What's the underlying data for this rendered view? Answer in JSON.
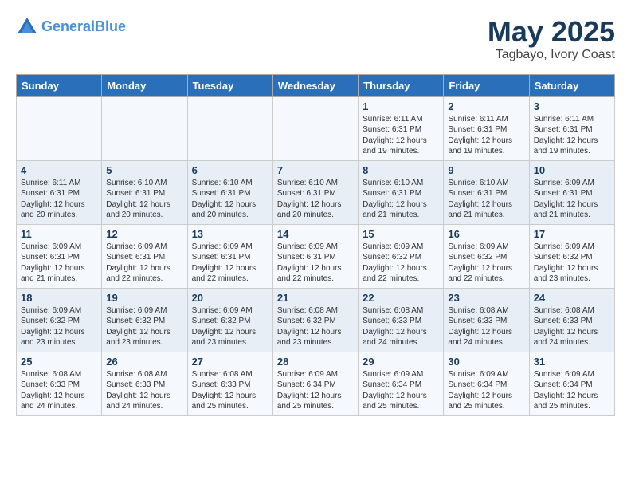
{
  "header": {
    "logo_line1": "General",
    "logo_line2": "Blue",
    "month": "May 2025",
    "location": "Tagbayo, Ivory Coast"
  },
  "days_of_week": [
    "Sunday",
    "Monday",
    "Tuesday",
    "Wednesday",
    "Thursday",
    "Friday",
    "Saturday"
  ],
  "weeks": [
    [
      {
        "day": "",
        "info": ""
      },
      {
        "day": "",
        "info": ""
      },
      {
        "day": "",
        "info": ""
      },
      {
        "day": "",
        "info": ""
      },
      {
        "day": "1",
        "info": "Sunrise: 6:11 AM\nSunset: 6:31 PM\nDaylight: 12 hours\nand 19 minutes."
      },
      {
        "day": "2",
        "info": "Sunrise: 6:11 AM\nSunset: 6:31 PM\nDaylight: 12 hours\nand 19 minutes."
      },
      {
        "day": "3",
        "info": "Sunrise: 6:11 AM\nSunset: 6:31 PM\nDaylight: 12 hours\nand 19 minutes."
      }
    ],
    [
      {
        "day": "4",
        "info": "Sunrise: 6:11 AM\nSunset: 6:31 PM\nDaylight: 12 hours\nand 20 minutes."
      },
      {
        "day": "5",
        "info": "Sunrise: 6:10 AM\nSunset: 6:31 PM\nDaylight: 12 hours\nand 20 minutes."
      },
      {
        "day": "6",
        "info": "Sunrise: 6:10 AM\nSunset: 6:31 PM\nDaylight: 12 hours\nand 20 minutes."
      },
      {
        "day": "7",
        "info": "Sunrise: 6:10 AM\nSunset: 6:31 PM\nDaylight: 12 hours\nand 20 minutes."
      },
      {
        "day": "8",
        "info": "Sunrise: 6:10 AM\nSunset: 6:31 PM\nDaylight: 12 hours\nand 21 minutes."
      },
      {
        "day": "9",
        "info": "Sunrise: 6:10 AM\nSunset: 6:31 PM\nDaylight: 12 hours\nand 21 minutes."
      },
      {
        "day": "10",
        "info": "Sunrise: 6:09 AM\nSunset: 6:31 PM\nDaylight: 12 hours\nand 21 minutes."
      }
    ],
    [
      {
        "day": "11",
        "info": "Sunrise: 6:09 AM\nSunset: 6:31 PM\nDaylight: 12 hours\nand 21 minutes."
      },
      {
        "day": "12",
        "info": "Sunrise: 6:09 AM\nSunset: 6:31 PM\nDaylight: 12 hours\nand 22 minutes."
      },
      {
        "day": "13",
        "info": "Sunrise: 6:09 AM\nSunset: 6:31 PM\nDaylight: 12 hours\nand 22 minutes."
      },
      {
        "day": "14",
        "info": "Sunrise: 6:09 AM\nSunset: 6:31 PM\nDaylight: 12 hours\nand 22 minutes."
      },
      {
        "day": "15",
        "info": "Sunrise: 6:09 AM\nSunset: 6:32 PM\nDaylight: 12 hours\nand 22 minutes."
      },
      {
        "day": "16",
        "info": "Sunrise: 6:09 AM\nSunset: 6:32 PM\nDaylight: 12 hours\nand 22 minutes."
      },
      {
        "day": "17",
        "info": "Sunrise: 6:09 AM\nSunset: 6:32 PM\nDaylight: 12 hours\nand 23 minutes."
      }
    ],
    [
      {
        "day": "18",
        "info": "Sunrise: 6:09 AM\nSunset: 6:32 PM\nDaylight: 12 hours\nand 23 minutes."
      },
      {
        "day": "19",
        "info": "Sunrise: 6:09 AM\nSunset: 6:32 PM\nDaylight: 12 hours\nand 23 minutes."
      },
      {
        "day": "20",
        "info": "Sunrise: 6:09 AM\nSunset: 6:32 PM\nDaylight: 12 hours\nand 23 minutes."
      },
      {
        "day": "21",
        "info": "Sunrise: 6:08 AM\nSunset: 6:32 PM\nDaylight: 12 hours\nand 23 minutes."
      },
      {
        "day": "22",
        "info": "Sunrise: 6:08 AM\nSunset: 6:33 PM\nDaylight: 12 hours\nand 24 minutes."
      },
      {
        "day": "23",
        "info": "Sunrise: 6:08 AM\nSunset: 6:33 PM\nDaylight: 12 hours\nand 24 minutes."
      },
      {
        "day": "24",
        "info": "Sunrise: 6:08 AM\nSunset: 6:33 PM\nDaylight: 12 hours\nand 24 minutes."
      }
    ],
    [
      {
        "day": "25",
        "info": "Sunrise: 6:08 AM\nSunset: 6:33 PM\nDaylight: 12 hours\nand 24 minutes."
      },
      {
        "day": "26",
        "info": "Sunrise: 6:08 AM\nSunset: 6:33 PM\nDaylight: 12 hours\nand 24 minutes."
      },
      {
        "day": "27",
        "info": "Sunrise: 6:08 AM\nSunset: 6:33 PM\nDaylight: 12 hours\nand 25 minutes."
      },
      {
        "day": "28",
        "info": "Sunrise: 6:09 AM\nSunset: 6:34 PM\nDaylight: 12 hours\nand 25 minutes."
      },
      {
        "day": "29",
        "info": "Sunrise: 6:09 AM\nSunset: 6:34 PM\nDaylight: 12 hours\nand 25 minutes."
      },
      {
        "day": "30",
        "info": "Sunrise: 6:09 AM\nSunset: 6:34 PM\nDaylight: 12 hours\nand 25 minutes."
      },
      {
        "day": "31",
        "info": "Sunrise: 6:09 AM\nSunset: 6:34 PM\nDaylight: 12 hours\nand 25 minutes."
      }
    ]
  ]
}
